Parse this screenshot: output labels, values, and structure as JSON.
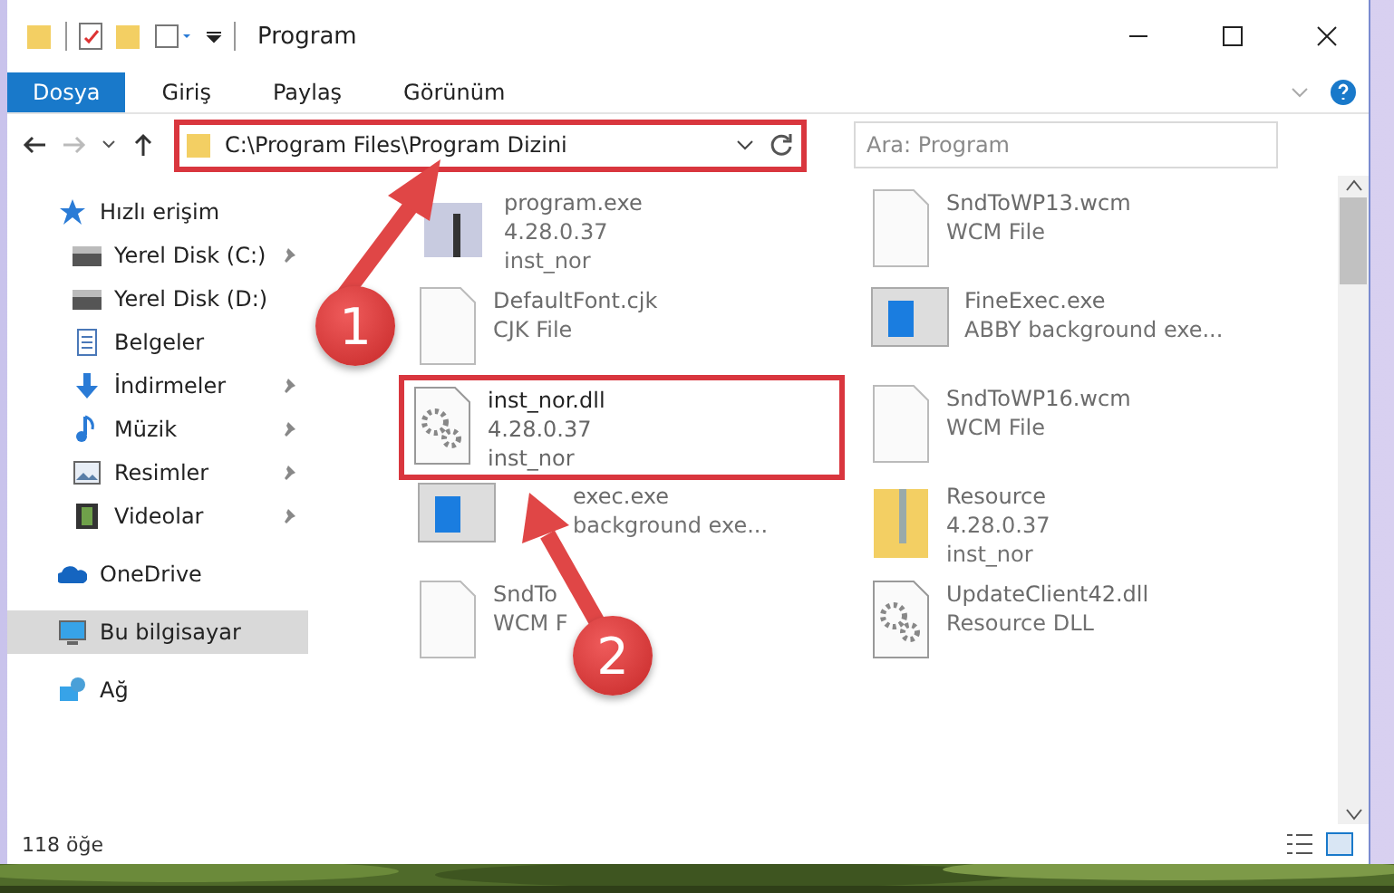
{
  "window": {
    "title": "Program"
  },
  "ribbon": {
    "tabs": [
      {
        "label": "Dosya",
        "selected": true
      },
      {
        "label": "Giriş",
        "selected": false
      },
      {
        "label": "Paylaş",
        "selected": false
      },
      {
        "label": "Görünüm",
        "selected": false
      }
    ]
  },
  "address": {
    "path": "C:\\Program Files\\Program Dizini",
    "highlighted": true
  },
  "search": {
    "placeholder": "Ara: Program"
  },
  "sidebar": {
    "items": [
      {
        "label": "Hızlı erişim",
        "kind": "star",
        "pinned": false,
        "selected": false,
        "children": [
          {
            "label": "Yerel Disk (C:)",
            "kind": "drive",
            "pinned": true,
            "selected": false
          },
          {
            "label": "Yerel Disk (D:)",
            "kind": "drive",
            "pinned": false,
            "selected": false
          },
          {
            "label": "Belgeler",
            "kind": "document",
            "pinned": false,
            "selected": false
          },
          {
            "label": "İndirmeler",
            "kind": "download",
            "pinned": true,
            "selected": false
          },
          {
            "label": "Müzik",
            "kind": "music",
            "pinned": true,
            "selected": false
          },
          {
            "label": "Resimler",
            "kind": "pictures",
            "pinned": true,
            "selected": false
          },
          {
            "label": "Videolar",
            "kind": "video",
            "pinned": true,
            "selected": false
          }
        ]
      },
      {
        "label": "OneDrive",
        "kind": "cloud",
        "pinned": false,
        "selected": false
      },
      {
        "label": "Bu bilgisayar",
        "kind": "computer",
        "pinned": false,
        "selected": true
      },
      {
        "label": "Ağ",
        "kind": "network",
        "pinned": false,
        "selected": false
      }
    ]
  },
  "files": [
    {
      "name": "program.exe",
      "lines": [
        "4.28.0.37",
        "inst_nor"
      ],
      "kind": "app",
      "blurred": true,
      "highlighted": false
    },
    {
      "name": "SndToWP13.wcm",
      "lines": [
        "WCM File"
      ],
      "kind": "blank",
      "blurred": true,
      "highlighted": false
    },
    {
      "name": "DefaultFont.cjk",
      "lines": [
        "CJK File"
      ],
      "kind": "blank",
      "blurred": true,
      "highlighted": false
    },
    {
      "name": "FineExec.exe",
      "lines": [
        "ABBY background exe..."
      ],
      "kind": "window",
      "blurred": true,
      "highlighted": false
    },
    {
      "name": "inst_nor.dll",
      "lines": [
        "4.28.0.37",
        "inst_nor"
      ],
      "kind": "gear",
      "blurred": false,
      "highlighted": true
    },
    {
      "name": "SndToWP16.wcm",
      "lines": [
        "WCM File"
      ],
      "kind": "blank",
      "blurred": true,
      "highlighted": false
    },
    {
      "name": "exec.exe",
      "lines": [
        "background exe..."
      ],
      "kind": "window",
      "blurred": true,
      "highlighted": false
    },
    {
      "name": "Resource",
      "lines": [
        "4.28.0.37",
        "inst_nor"
      ],
      "kind": "folder",
      "blurred": true,
      "highlighted": false
    },
    {
      "name": "SndTo",
      "lines": [
        "WCM F"
      ],
      "kind": "blank",
      "blurred": true,
      "highlighted": false
    },
    {
      "name": "UpdateClient42.dll",
      "lines": [
        "Resource DLL"
      ],
      "kind": "gear",
      "blurred": true,
      "highlighted": false
    }
  ],
  "status_bar": {
    "count": "118 öğe"
  },
  "callouts": [
    {
      "number": "1"
    },
    {
      "number": "2"
    }
  ]
}
